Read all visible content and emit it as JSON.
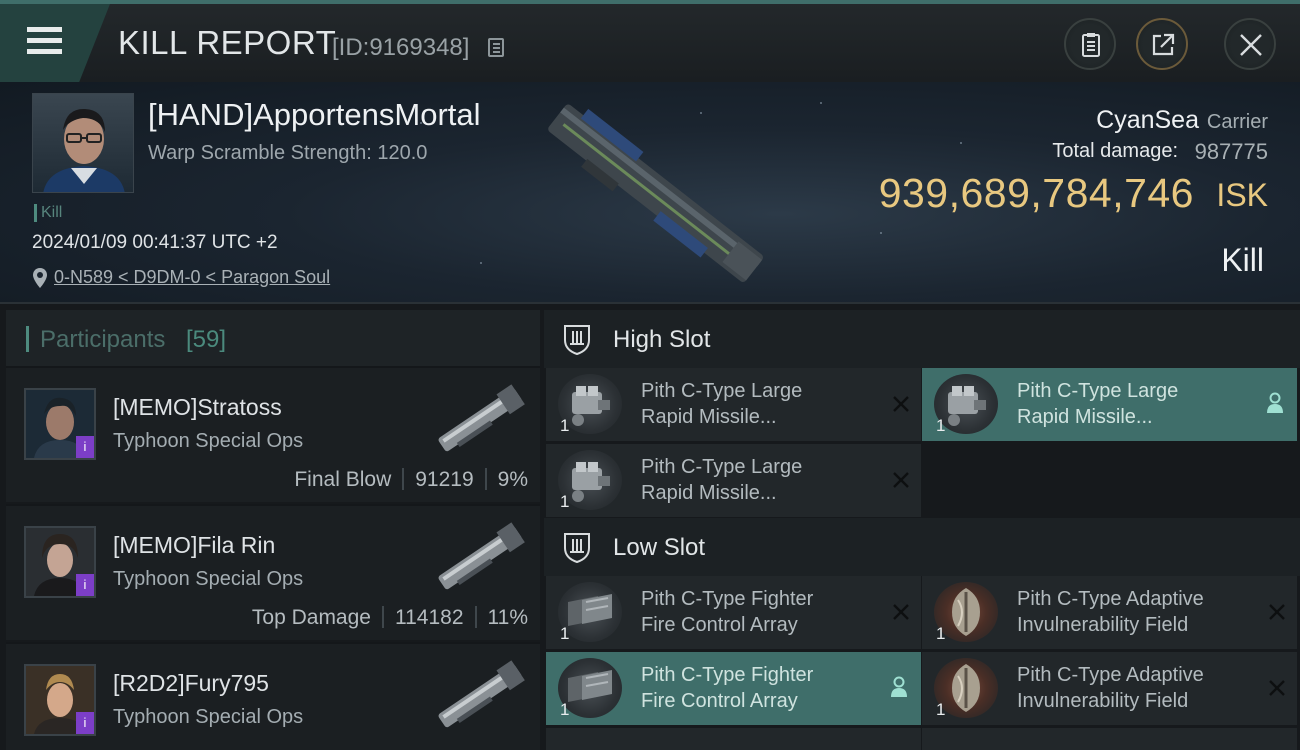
{
  "header": {
    "title": "KILL REPORT",
    "report_id": "[ID:9169348]"
  },
  "victim": {
    "name": "[HAND]ApportensMortal",
    "warp_scramble": "Warp Scramble Strength: 120.0",
    "tag": "Kill",
    "timestamp": "2024/01/09 00:41:37 UTC +2",
    "location": "0-N589 < D9DM-0 < Paragon Soul",
    "ship_name": "CyanSea",
    "ship_class": "Carrier",
    "total_damage_label": "Total damage:",
    "total_damage": "987775",
    "isk_value": "939,689,784,746",
    "isk_unit": "ISK",
    "kill_type": "Kill"
  },
  "participants": {
    "title": "Participants",
    "count": "[59]",
    "items": [
      {
        "name": "[MEMO]Stratoss",
        "ship": "Typhoon Special Ops",
        "role": "Final Blow",
        "damage": "91219",
        "percent": "9%"
      },
      {
        "name": "[MEMO]Fila Rin",
        "ship": "Typhoon Special Ops",
        "role": "Top Damage",
        "damage": "114182",
        "percent": "11%"
      },
      {
        "name": "[R2D2]Fury795",
        "ship": "Typhoon Special Ops",
        "role": "",
        "damage": "",
        "percent": ""
      }
    ]
  },
  "slots": {
    "high": {
      "title": "High Slot",
      "items": [
        {
          "line1": "Pith C-Type Large",
          "line2": "Rapid Missile...",
          "qty": "1"
        },
        {
          "line1": "Pith C-Type Large",
          "line2": "Rapid Missile...",
          "qty": "1"
        },
        {
          "line1": "Pith C-Type Large",
          "line2": "Rapid Missile...",
          "qty": "1"
        }
      ]
    },
    "low": {
      "title": "Low Slot",
      "items": [
        {
          "line1": "Pith C-Type Fighter",
          "line2": "Fire Control Array",
          "qty": "1"
        },
        {
          "line1": "Pith C-Type Adaptive",
          "line2": "Invulnerability Field",
          "qty": "1"
        },
        {
          "line1": "Pith C-Type Fighter",
          "line2": "Fire Control Array",
          "qty": "1"
        },
        {
          "line1": "Pith C-Type Adaptive",
          "line2": "Invulnerability Field",
          "qty": "1"
        }
      ]
    }
  },
  "colors": {
    "accent": "#3f6e6a",
    "isk_gold": "#e8c880",
    "badge_purple": "#7c3ec7"
  }
}
